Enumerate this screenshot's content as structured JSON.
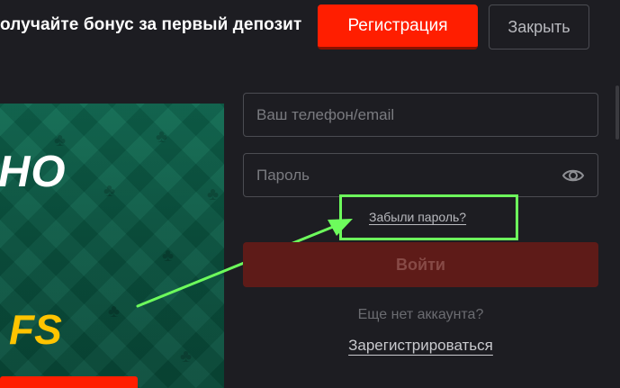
{
  "header": {
    "promo_text": "олучайте бонус за первый депозит",
    "register_label": "Регистрация",
    "close_label": "Закрыть"
  },
  "banner": {
    "title": "НО",
    "free_spins_label": "FS"
  },
  "login_form": {
    "login_placeholder": "Ваш телефон/email",
    "password_placeholder": "Пароль",
    "forgot_password_label": "Забыли пароль?",
    "submit_label": "Войти",
    "no_account_text": "Еще нет аккаунта?",
    "register_link_label": "Зарегистрироваться"
  },
  "icons": {
    "password_toggle": "eye-icon",
    "banner_decoration": "club-suit-icon"
  },
  "colors": {
    "accent_red": "#ff1e00",
    "disabled_red": "#5e1b18",
    "banner_green": "#0c5a45",
    "fs_yellow": "#ffc400",
    "highlight_green": "#6dfc5c",
    "background": "#1d1d22"
  }
}
